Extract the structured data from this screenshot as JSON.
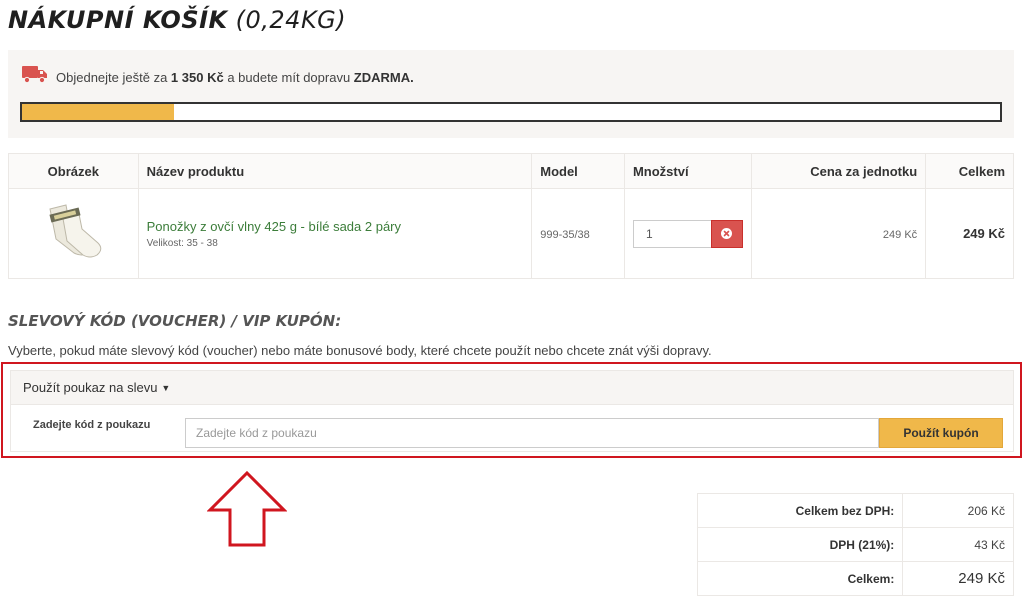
{
  "header": {
    "title": "Nákupní košík",
    "weight": "(0,24kg)"
  },
  "shipping": {
    "prefix": "Objednejte ještě za",
    "amount": "1 350 Kč",
    "middle": "a budete mít dopravu",
    "free": "ZDARMA.",
    "progress_percent": 15.5,
    "icon": "truck-icon",
    "icon_color": "#d9534f"
  },
  "cart": {
    "columns": [
      "Obrázek",
      "Název produktu",
      "Model",
      "Množství",
      "Cena za jednotku",
      "Celkem"
    ],
    "items": [
      {
        "name": "Ponožky z ovčí vlny 425 g - bílé sada 2 páry",
        "meta": "Velikost: 35 - 38",
        "model": "999-35/38",
        "quantity": "1",
        "unit_price": "249 Kč",
        "total": "249 Kč"
      }
    ]
  },
  "voucher": {
    "heading": "Slevový kód (voucher) / VIP kupón:",
    "description": "Vyberte, pokud máte slevový kód (voucher) nebo máte bonusové body, které chcete použít nebo chcete znát výši dopravy.",
    "panel_title": "Použít poukaz na slevu",
    "label": "Zadejte kód z poukazu",
    "placeholder": "Zadejte kód z poukazu",
    "button": "Použít kupón"
  },
  "totals": [
    {
      "label": "Celkem bez DPH:",
      "value": "206 Kč"
    },
    {
      "label": "DPH (21%):",
      "value": "43 Kč"
    },
    {
      "label": "Celkem:",
      "value": "249 Kč"
    }
  ],
  "colors": {
    "accent": "#f0b84a",
    "highlight": "#d0161f",
    "product_link": "#3c7d3a",
    "remove": "#d9534f"
  }
}
